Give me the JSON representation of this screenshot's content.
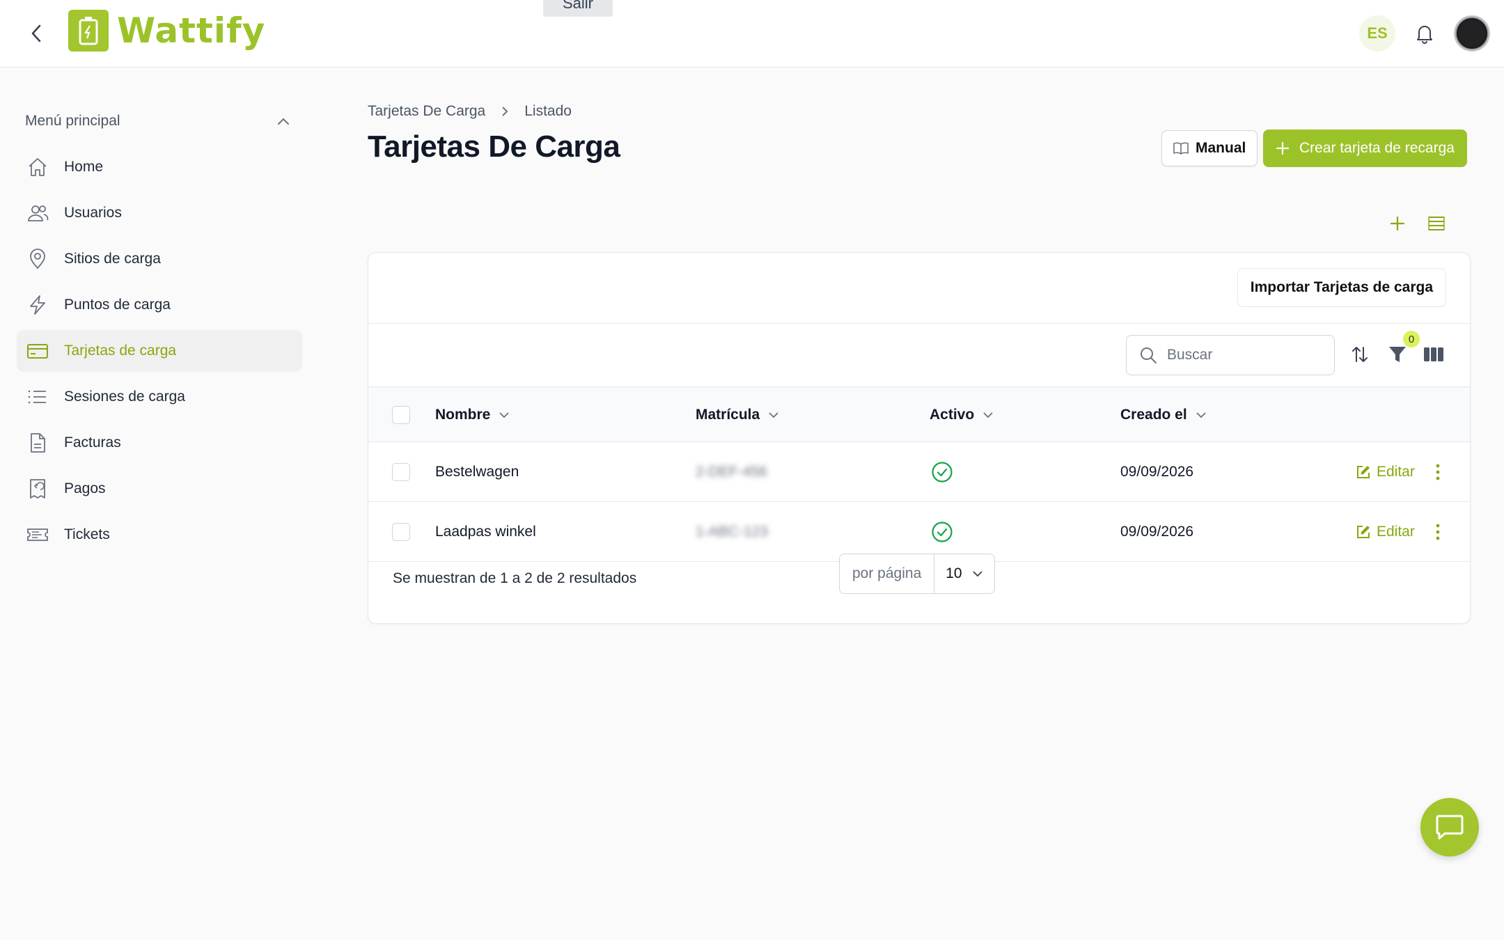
{
  "app": {
    "name": "Wattify",
    "language": "ES"
  },
  "impersonation": {
    "exit_label": "Salir"
  },
  "sidebar": {
    "heading": "Menú principal",
    "items": [
      {
        "label": "Home",
        "icon": "home-icon"
      },
      {
        "label": "Usuarios",
        "icon": "users-icon"
      },
      {
        "label": "Sitios de carga",
        "icon": "map-pin-icon"
      },
      {
        "label": "Puntos de carga",
        "icon": "bolt-icon"
      },
      {
        "label": "Tarjetas de carga",
        "icon": "credit-card-icon",
        "active": true
      },
      {
        "label": "Sesiones de carga",
        "icon": "list-icon"
      },
      {
        "label": "Facturas",
        "icon": "document-icon"
      },
      {
        "label": "Pagos",
        "icon": "receipt-refund-icon"
      },
      {
        "label": "Tickets",
        "icon": "ticket-icon"
      }
    ]
  },
  "breadcrumb": {
    "parent": "Tarjetas De Carga",
    "current": "Listado"
  },
  "page": {
    "title": "Tarjetas De Carga"
  },
  "actions": {
    "manual_label": "Manual",
    "create_label": "Crear tarjeta de recarga",
    "import_label": "Importar Tarjetas de carga"
  },
  "search": {
    "placeholder": "Buscar"
  },
  "filters": {
    "active_count": "0"
  },
  "table": {
    "columns": [
      "Nombre",
      "Matrícula",
      "Activo",
      "Creado el"
    ],
    "rows": [
      {
        "nombre": "Bestelwagen",
        "matricula": "2-DEF-456",
        "activo": true,
        "creado": "09/09/2026",
        "edit": "Editar"
      },
      {
        "nombre": "Laadpas winkel",
        "matricula": "1-ABC-123",
        "activo": true,
        "creado": "09/09/2026",
        "edit": "Editar"
      }
    ]
  },
  "pagination": {
    "summary": "Se muestran de 1 a 2 de 2 resultados",
    "per_page_label": "por página",
    "per_page_value": "10"
  },
  "colors": {
    "accent": "#9cc22a",
    "accent_text": "#86a80f",
    "success": "#16a34a"
  }
}
